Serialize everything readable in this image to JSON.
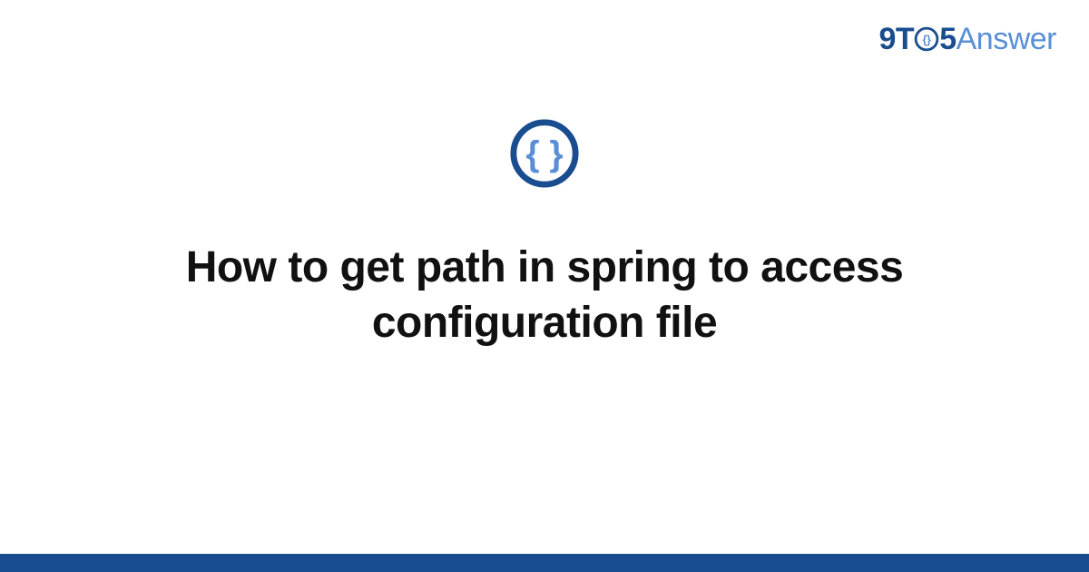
{
  "logo": {
    "nine": "9",
    "t": "T",
    "five": "5",
    "answer": "Answer"
  },
  "icon": {
    "name": "curly-braces-icon"
  },
  "title": "How to get path in spring to access configuration file",
  "colors": {
    "brand_dark": "#1a4d8f",
    "brand_light": "#5a8fd6",
    "text": "#111111",
    "background": "#ffffff"
  }
}
